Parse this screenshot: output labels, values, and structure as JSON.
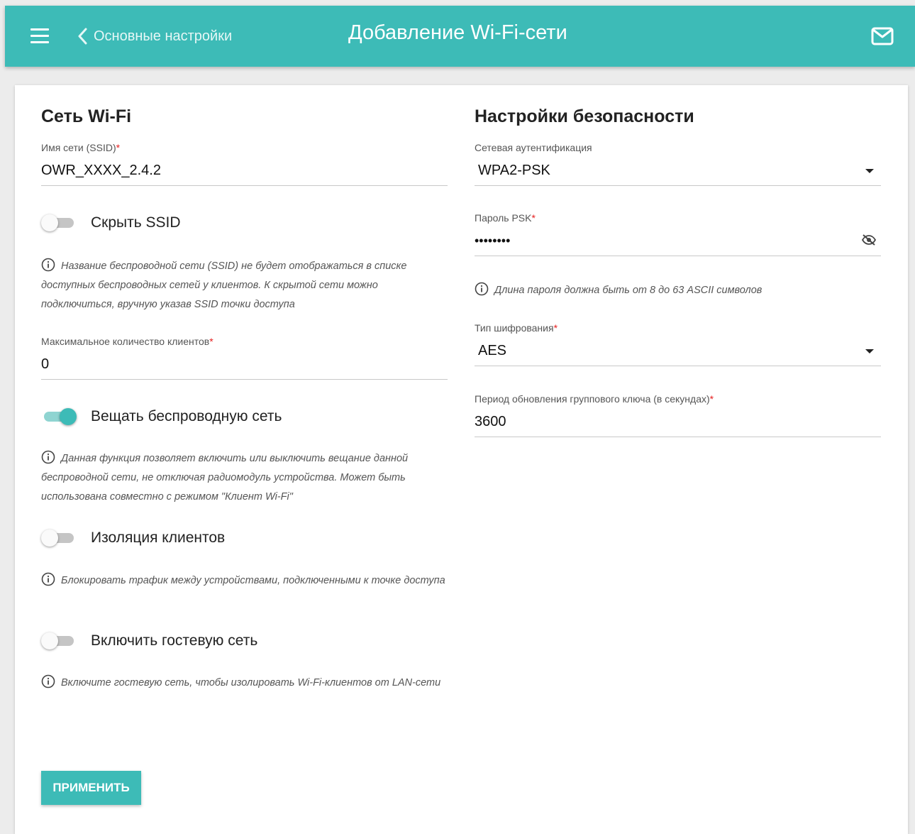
{
  "header": {
    "back_label": "Основные настройки",
    "title": "Добавление Wi-Fi-сети",
    "icons": [
      "menu-icon",
      "chevron-left-icon",
      "mail-icon"
    ]
  },
  "left": {
    "section_title": "Сеть Wi-Fi",
    "ssid": {
      "label": "Имя сети (SSID)",
      "required_mark": "*",
      "value": "OWR_XXXX_2.4.2"
    },
    "hide_ssid": {
      "label": "Скрыть SSID",
      "enabled": false
    },
    "hide_ssid_hint": "Название беспроводной сети (SSID) не будет отображаться в списке доступных беспроводных сетей у клиентов. К скрытой сети можно подключиться, вручную указав SSID точки доступа",
    "max_clients": {
      "label": "Максимальное количество клиентов",
      "required_mark": "*",
      "value": "0"
    },
    "broadcast": {
      "label": "Вещать беспроводную сеть",
      "enabled": true
    },
    "broadcast_hint": "Данная функция позволяет включить или выключить вещание данной беспроводной сети, не отключая радиомодуль устройства. Может быть использована совместно с режимом \"Клиент Wi-Fi\"",
    "isolation": {
      "label": "Изоляция клиентов",
      "enabled": false
    },
    "isolation_hint": "Блокировать трафик между устройствами, подключенными к точке доступа",
    "guest": {
      "label": "Включить гостевую сеть",
      "enabled": false
    },
    "guest_hint": "Включите гостевую сеть, чтобы изолировать Wi-Fi-клиентов от LAN-сети"
  },
  "right": {
    "section_title": "Настройки безопасности",
    "auth": {
      "label": "Сетевая аутентификация",
      "value": "WPA2-PSK"
    },
    "psk": {
      "label": "Пароль PSK",
      "required_mark": "*",
      "value": "••••••••"
    },
    "psk_hint": "Длина пароля должна быть от 8 до 63 ASCII символов",
    "cipher": {
      "label": "Тип шифрования",
      "required_mark": "*",
      "value": "AES"
    },
    "rekey": {
      "label": "Период обновления группового ключа (в секундах)",
      "required_mark": "*",
      "value": "3600"
    }
  },
  "apply_label": "ПРИМЕНИТЬ",
  "colors": {
    "accent": "#3dbbb7",
    "required": "#e52020",
    "background": "#ececec"
  }
}
